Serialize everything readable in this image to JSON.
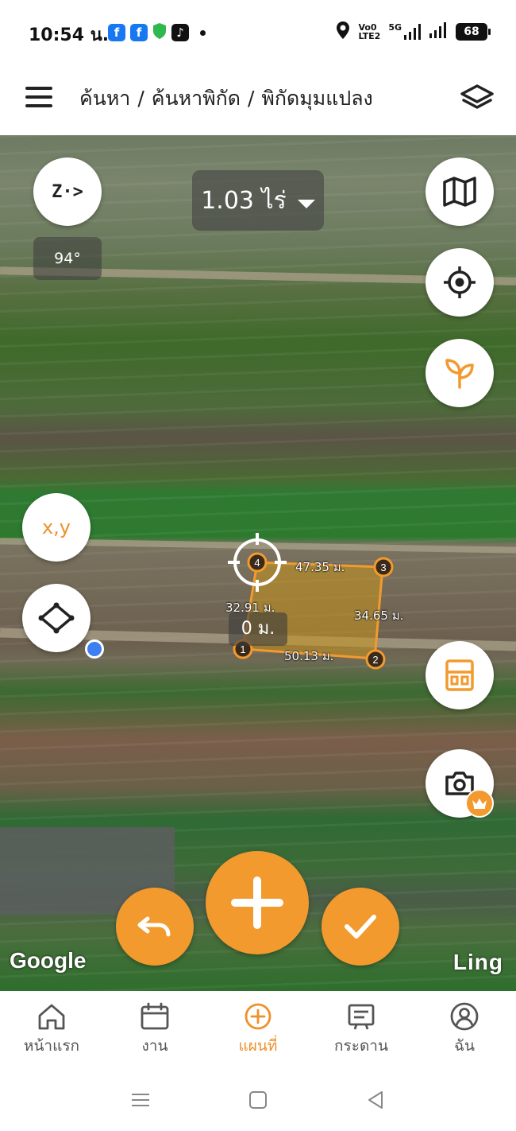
{
  "status_bar": {
    "time": "10:54 น.",
    "apps": [
      "facebook-icon",
      "facebook-icon",
      "shield-icon",
      "tiktok-icon"
    ],
    "volte": "Vo0",
    "lte": "LTE2",
    "net": "5G",
    "battery": "68"
  },
  "header": {
    "breadcrumb": [
      "ค้นหา",
      "ค้นหาพิกัด",
      "พิกัดมุมแปลง"
    ],
    "separator": "/"
  },
  "map": {
    "compass_label": "Z·>",
    "heading": "94°",
    "area": "1.03 ไร่",
    "xy_label": "x,y",
    "perimeter_label": "0 ม.",
    "points": [
      "1",
      "2",
      "3",
      "4"
    ],
    "measurements": {
      "side_top": "47.35 ม.",
      "side_right": "34.65 ม.",
      "side_bottom": "50.13 ม.",
      "side_left": "32.91 ม."
    },
    "google_label": "Google",
    "provider_label": "Ling"
  },
  "bottom_nav": [
    {
      "label": "หน้าแรก",
      "icon": "home-icon",
      "active": false
    },
    {
      "label": "งาน",
      "icon": "calendar-icon",
      "active": false
    },
    {
      "label": "แผนที่",
      "icon": "plus-circle-icon",
      "active": true
    },
    {
      "label": "กระดาน",
      "icon": "board-icon",
      "active": false
    },
    {
      "label": "ฉัน",
      "icon": "profile-icon",
      "active": false
    }
  ],
  "colors": {
    "accent": "#f29a2e",
    "plot_fill": "#c8961e",
    "gps": "#3d7ef0"
  }
}
